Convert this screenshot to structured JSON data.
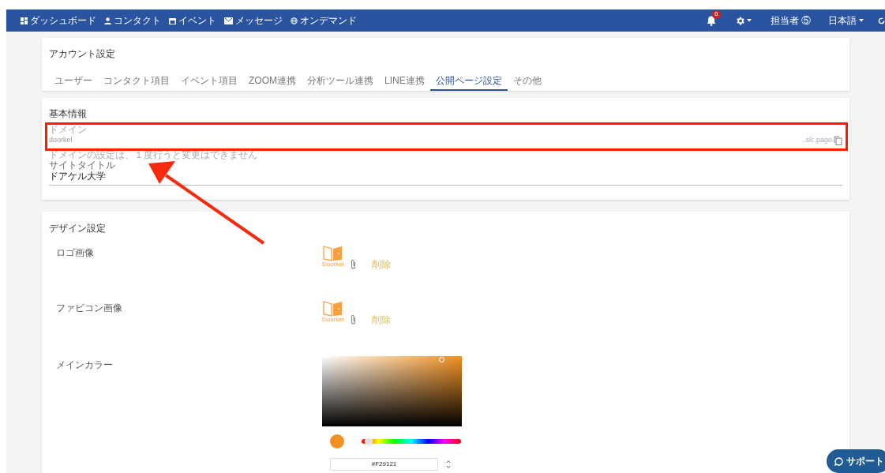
{
  "nav": {
    "items": [
      {
        "label": "ダッシュボード",
        "kind": "dashboard"
      },
      {
        "label": "コンタクト",
        "kind": "person"
      },
      {
        "label": "イベント",
        "kind": "calendar"
      },
      {
        "label": "メッセージ",
        "kind": "mail"
      },
      {
        "label": "オンデマンド",
        "kind": "globe"
      }
    ],
    "notifications": "6",
    "user": "担当者 ⑤",
    "language": "日本語"
  },
  "account": {
    "title": "アカウント設定",
    "tabs": [
      {
        "label": "ユーザー",
        "selected": false
      },
      {
        "label": "コンタクト項目",
        "selected": false
      },
      {
        "label": "イベント項目",
        "selected": false
      },
      {
        "label": "ZOOM連携",
        "selected": false
      },
      {
        "label": "分析ツール連携",
        "selected": false
      },
      {
        "label": "LINE連携",
        "selected": false
      },
      {
        "label": "公開ページ設定",
        "selected": true
      },
      {
        "label": "その他",
        "selected": false
      }
    ]
  },
  "basic": {
    "title": "基本情報",
    "domain": {
      "label": "ドメイン",
      "value": "doorkel",
      "suffix": ".slc.page",
      "hint": "ドメインの設定は、１度行うと変更はできません"
    },
    "site_title": {
      "label": "サイトタイトル",
      "value": "ドアケル大学"
    }
  },
  "design": {
    "title": "デザイン設定",
    "images": [
      {
        "label": "ロゴ画像",
        "logo_text": "Doorkel",
        "delete": "削除"
      },
      {
        "label": "ファビコン画像",
        "logo_text": "Doorkel",
        "delete": "削除"
      }
    ],
    "main_color": {
      "label": "メインカラー",
      "color": "#f29121",
      "hue": {
        "level": 0.07
      },
      "value": "#F29121"
    }
  },
  "support": "サポート"
}
